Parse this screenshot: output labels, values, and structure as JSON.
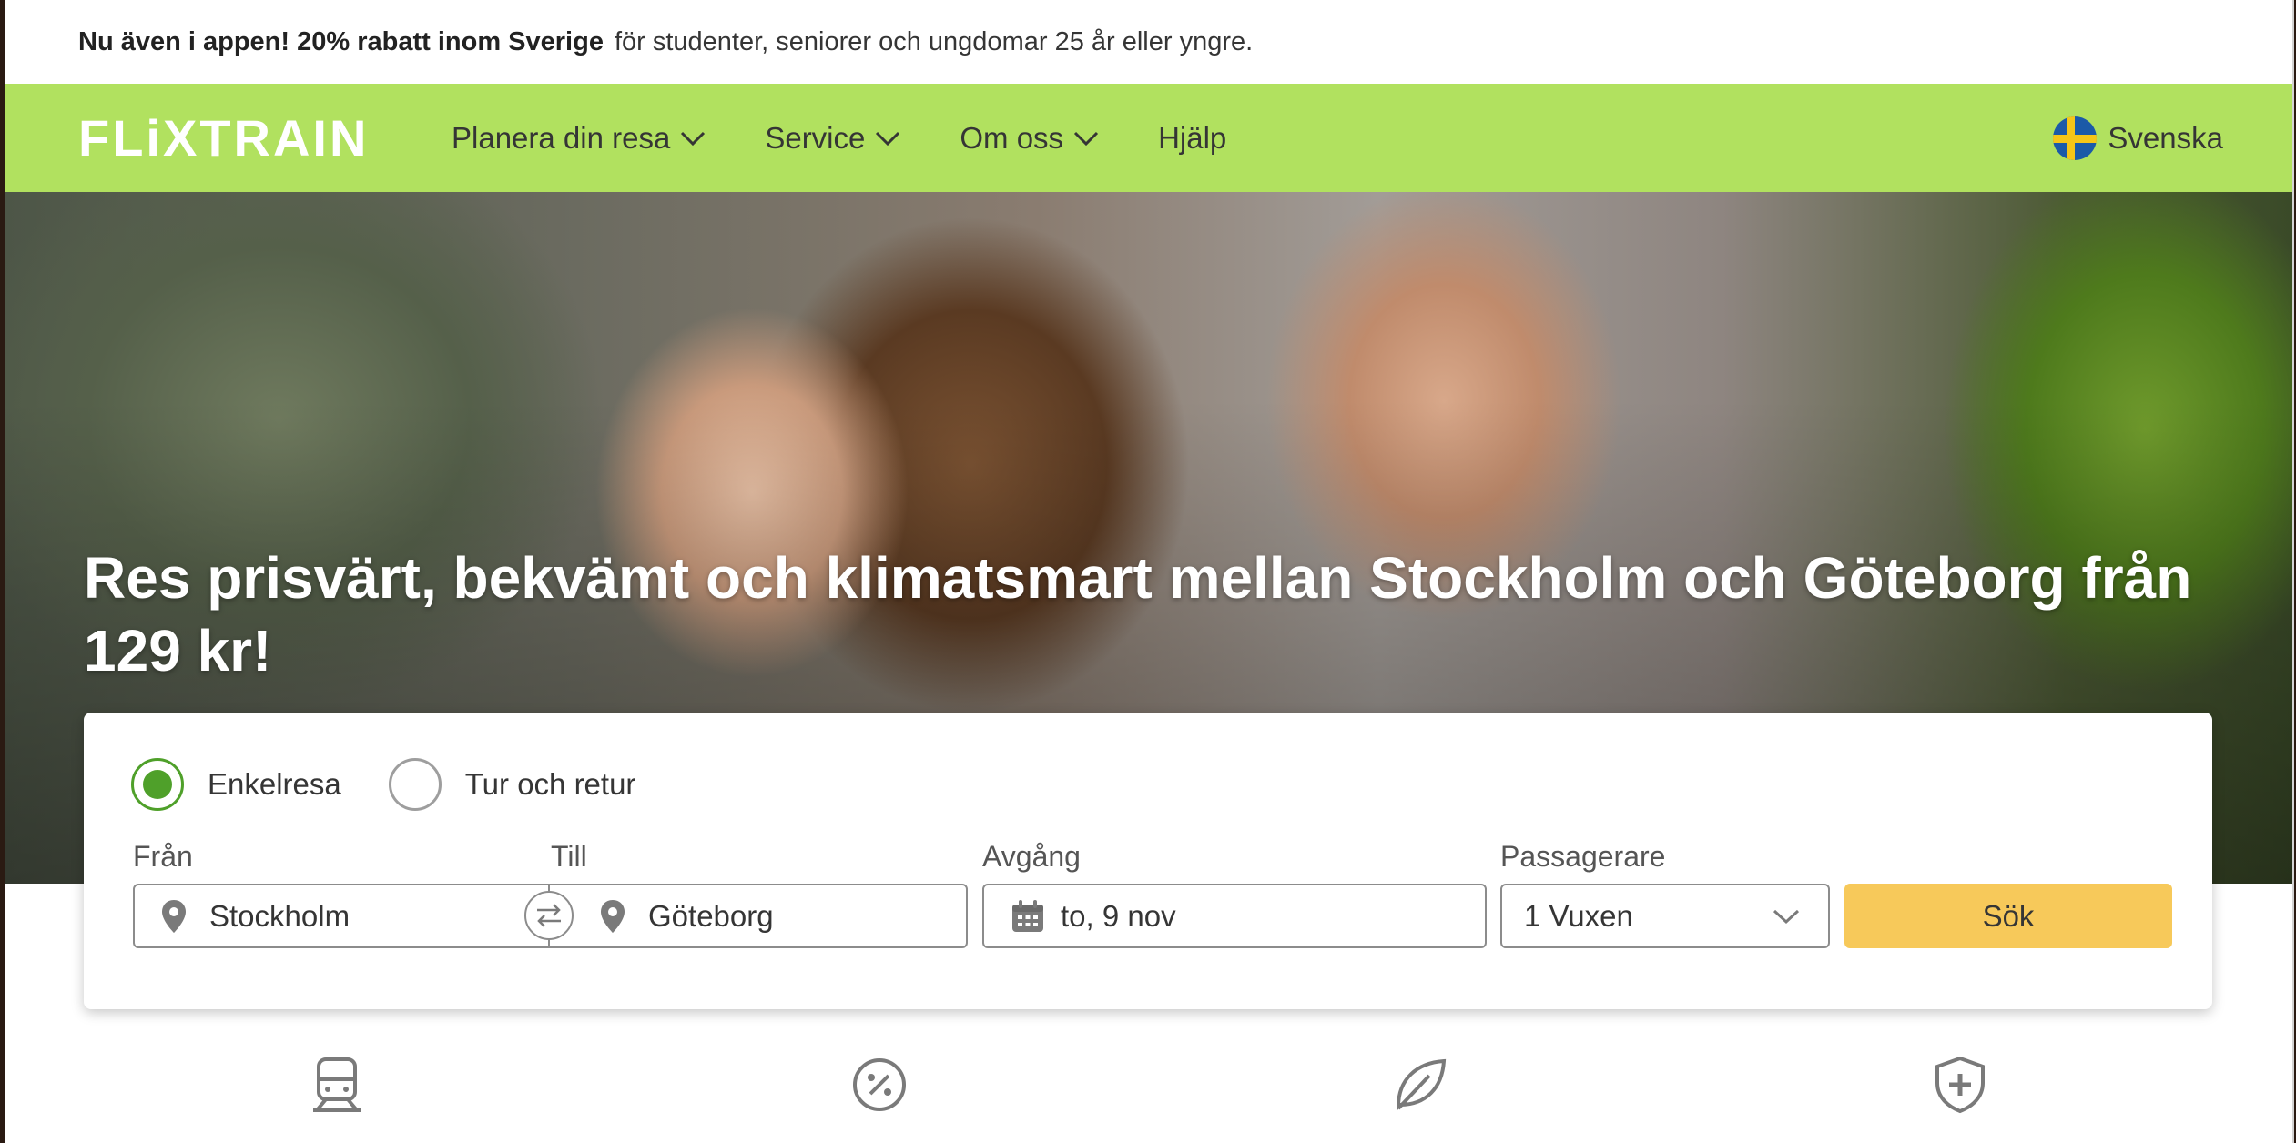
{
  "promo": {
    "bold": "Nu även i appen! 20% rabatt inom Sverige",
    "text": "för studenter, seniorer och ungdomar 25 år eller yngre."
  },
  "header": {
    "logo": "FLiXTRAIN",
    "nav": [
      {
        "label": "Planera din resa",
        "dropdown": true
      },
      {
        "label": "Service",
        "dropdown": true
      },
      {
        "label": "Om oss",
        "dropdown": true
      },
      {
        "label": "Hjälp",
        "dropdown": false
      }
    ],
    "language": "Svenska",
    "flag_icon": "sweden-flag-icon"
  },
  "hero": {
    "title": "Res prisvärt, bekvämt och klimatsmart mellan Stockholm och Göteborg från 129 kr!"
  },
  "search": {
    "trip_types": [
      {
        "label": "Enkelresa",
        "selected": true
      },
      {
        "label": "Tur och retur",
        "selected": false
      }
    ],
    "from": {
      "label": "Från",
      "value": "Stockholm"
    },
    "to": {
      "label": "Till",
      "value": "Göteborg"
    },
    "departure": {
      "label": "Avgång",
      "value": "to, 9 nov"
    },
    "passengers": {
      "label": "Passagerare",
      "value": "1 Vuxen"
    },
    "submit": "Sök"
  },
  "features": [
    "train-icon",
    "discount-icon",
    "leaf-icon",
    "shield-plus-icon"
  ],
  "colors": {
    "brand_green": "#b1e15f",
    "radio_green": "#4fa02a",
    "search_button": "#f7c95a"
  }
}
